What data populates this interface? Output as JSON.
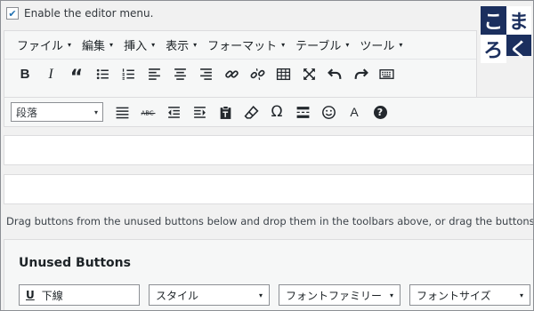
{
  "enable_editor_menu": {
    "label": "Enable the editor menu.",
    "checked": true,
    "check_glyph": "✔"
  },
  "logo": {
    "chars": [
      "こ",
      "ま",
      "ろ",
      "く"
    ]
  },
  "menubar": {
    "items": [
      {
        "label": "ファイル"
      },
      {
        "label": "編集"
      },
      {
        "label": "挿入"
      },
      {
        "label": "表示"
      },
      {
        "label": "フォーマット"
      },
      {
        "label": "テーブル"
      },
      {
        "label": "ツール"
      }
    ],
    "caret": "▾"
  },
  "toolbar1": {
    "bold": "B",
    "italic": "I",
    "blockquote": "“"
  },
  "toolbar2": {
    "format_select_value": "段落",
    "special_char": "Ω",
    "text_color": "A",
    "help": "?"
  },
  "help_text": "Drag buttons from the unused buttons below and drop them in the toolbars above, or drag the buttons in",
  "unused_buttons": {
    "title": "Unused Buttons",
    "underline": {
      "glyph": "U",
      "label": "下線"
    },
    "styles": "スタイル",
    "font_family": "フォントファミリー",
    "font_size": "フォントサイズ"
  },
  "colors": {
    "logo_bg": "#1b2f5e",
    "checkbox_tick": "#2271b1"
  }
}
